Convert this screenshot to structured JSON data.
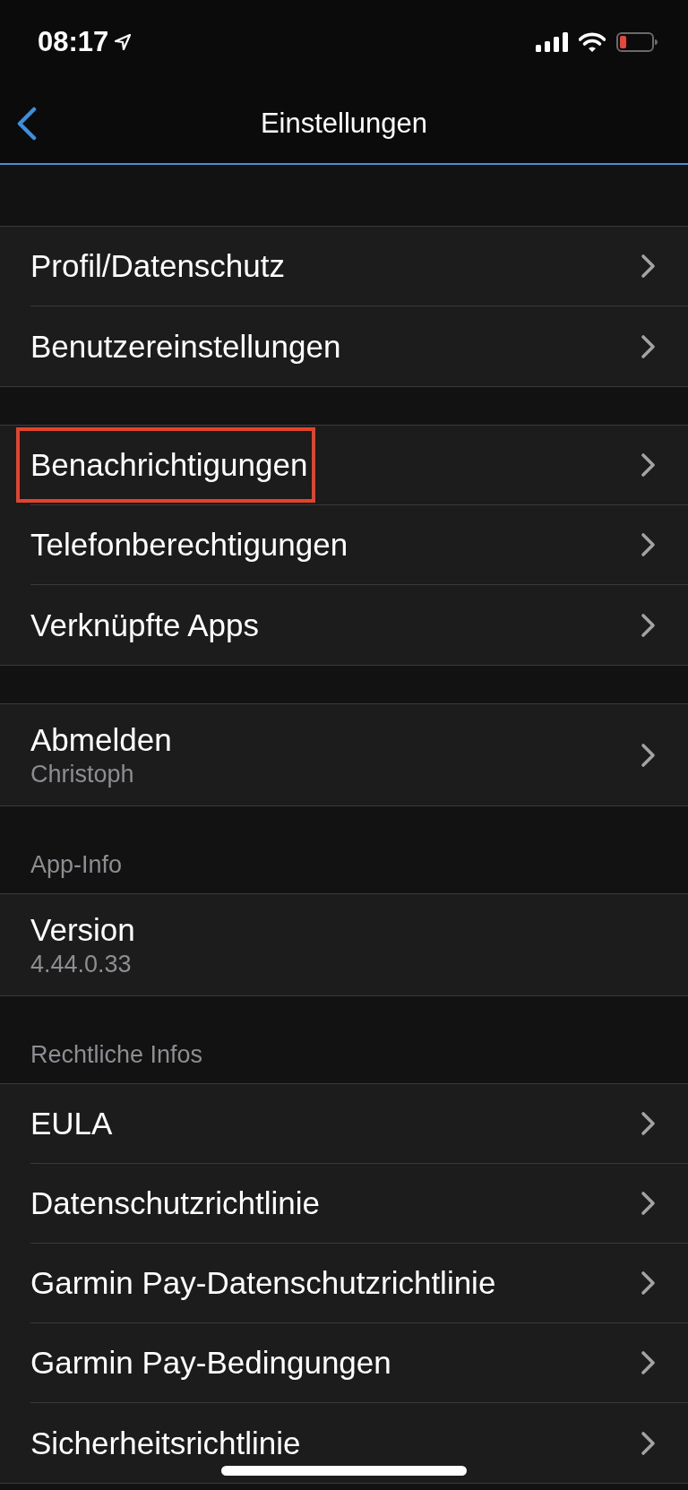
{
  "status_bar": {
    "time": "08:17"
  },
  "nav_bar": {
    "title": "Einstellungen"
  },
  "sections": [
    {
      "rows": [
        {
          "label": "Profil/Datenschutz",
          "chevron": true,
          "highlighted": false
        },
        {
          "label": "Benutzereinstellungen",
          "chevron": true,
          "highlighted": false
        }
      ]
    },
    {
      "rows": [
        {
          "label": "Benachrichtigungen",
          "chevron": true,
          "highlighted": true
        },
        {
          "label": "Telefonberechtigungen",
          "chevron": true,
          "highlighted": false
        },
        {
          "label": "Verknüpfte Apps",
          "chevron": true,
          "highlighted": false
        }
      ]
    },
    {
      "rows": [
        {
          "label": "Abmelden",
          "detail": "Christoph",
          "chevron": true,
          "highlighted": false
        }
      ]
    },
    {
      "header": "App-Info",
      "rows": [
        {
          "label": "Version",
          "detail": "4.44.0.33",
          "chevron": false,
          "highlighted": false
        }
      ]
    },
    {
      "header": "Rechtliche Infos",
      "rows": [
        {
          "label": "EULA",
          "chevron": true,
          "highlighted": false
        },
        {
          "label": "Datenschutzrichtlinie",
          "chevron": true,
          "highlighted": false
        },
        {
          "label": "Garmin Pay-Datenschutzrichtlinie",
          "chevron": true,
          "highlighted": false
        },
        {
          "label": "Garmin Pay-Bedingungen",
          "chevron": true,
          "highlighted": false
        },
        {
          "label": "Sicherheitsrichtlinie",
          "chevron": true,
          "highlighted": false
        }
      ]
    }
  ]
}
